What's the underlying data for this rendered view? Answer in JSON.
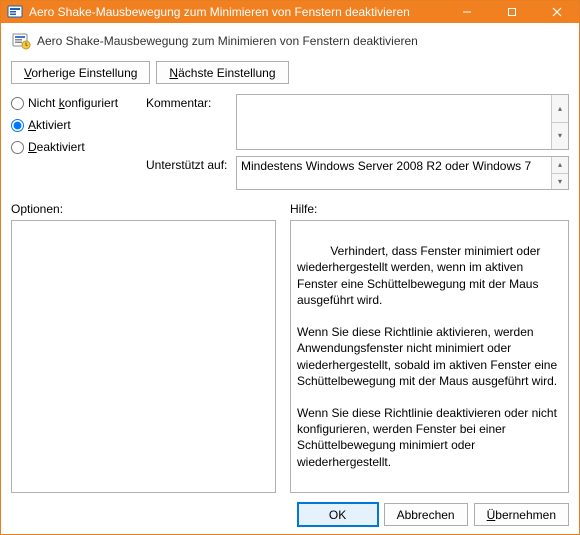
{
  "window": {
    "title": "Aero Shake-Mausbewegung zum Minimieren von Fenstern deaktivieren"
  },
  "header": {
    "text": "Aero Shake-Mausbewegung zum Minimieren von Fenstern deaktivieren"
  },
  "nav": {
    "prev": "Vorherige Einstellung",
    "next": "Nächste Einstellung"
  },
  "state": {
    "not_configured": "Nicht konfiguriert",
    "enabled": "Aktiviert",
    "disabled": "Deaktiviert",
    "selected": "enabled"
  },
  "fields": {
    "comment_label": "Kommentar:",
    "comment_value": "",
    "supported_label": "Unterstützt auf:",
    "supported_value": "Mindestens Windows Server 2008 R2 oder Windows 7"
  },
  "columns": {
    "options_label": "Optionen:",
    "options_value": "",
    "help_label": "Hilfe:",
    "help_value": "Verhindert, dass Fenster minimiert oder wiederhergestellt werden, wenn im aktiven Fenster eine Schüttelbewegung mit der Maus ausgeführt wird.\n\nWenn Sie diese Richtlinie aktivieren, werden Anwendungsfenster nicht minimiert oder wiederhergestellt, sobald im aktiven Fenster eine Schüttelbewegung mit der Maus ausgeführt wird.\n\nWenn Sie diese Richtlinie deaktivieren oder nicht konfigurieren, werden Fenster bei einer Schüttelbewegung minimiert oder wiederhergestellt."
  },
  "footer": {
    "ok": "OK",
    "cancel": "Abbrechen",
    "apply": "Übernehmen"
  }
}
